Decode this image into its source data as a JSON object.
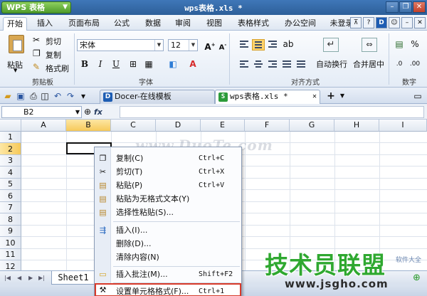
{
  "titlebar": {
    "app_button": "WPS 表格",
    "title": "wps表格.xls *"
  },
  "menu": {
    "tabs": [
      "开始",
      "插入",
      "页面布局",
      "公式",
      "数据",
      "审阅",
      "视图",
      "表格样式",
      "办公空间"
    ],
    "login": "未登录"
  },
  "ribbon": {
    "paste": "粘贴",
    "cut": "剪切",
    "copy": "复制",
    "format_painter": "格式刷",
    "clipboard_group": "剪贴板",
    "font_name": "宋体",
    "font_size": "12",
    "font_group": "字体",
    "bold": "B",
    "italic": "I",
    "underline": "U",
    "align_group": "对齐方式",
    "wrap_text": "自动换行",
    "merge_center": "合并居中",
    "number_group": "数字"
  },
  "doc_tabs": [
    {
      "label": "Docer-在线模板"
    },
    {
      "label": "wps表格.xls *"
    }
  ],
  "formula_bar": {
    "cell_ref": "B2",
    "fx": "fx"
  },
  "grid": {
    "columns": [
      "A",
      "B",
      "C",
      "D",
      "E",
      "F",
      "G",
      "H",
      "I"
    ],
    "rows": [
      "1",
      "2",
      "3",
      "4",
      "5",
      "6",
      "7",
      "8",
      "9",
      "10",
      "11",
      "12"
    ]
  },
  "sheet_tab": "Sheet1",
  "context_menu": {
    "items": [
      {
        "label": "复制(C)",
        "shortcut": "Ctrl+C"
      },
      {
        "label": "剪切(T)",
        "shortcut": "Ctrl+X"
      },
      {
        "label": "粘贴(P)",
        "shortcut": "Ctrl+V"
      },
      {
        "label": "粘贴为无格式文本(Y)",
        "shortcut": ""
      },
      {
        "label": "选择性粘贴(S)...",
        "shortcut": ""
      },
      {
        "label": "插入(I)...",
        "shortcut": ""
      },
      {
        "label": "删除(D)...",
        "shortcut": ""
      },
      {
        "label": "清除内容(N)",
        "shortcut": ""
      },
      {
        "label": "插入批注(M)...",
        "shortcut": "Shift+F2"
      },
      {
        "label": "设置单元格格式(F)...",
        "shortcut": "Ctrl+1"
      }
    ]
  },
  "watermarks": {
    "duote": "www.DuoTe.com",
    "jsgho_cn": "技术员联盟",
    "jsgho_url": "www.jsgho.com",
    "corner": "软件大全"
  },
  "colors": {
    "title_blue": "#2d5f99",
    "selection_yellow": "#f6c95a",
    "highlight_red": "#d83a2a",
    "watermark_green": "#2fa830"
  }
}
